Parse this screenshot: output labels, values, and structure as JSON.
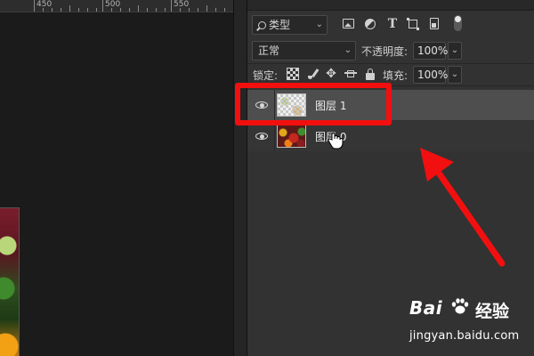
{
  "ruler": {
    "marks": [
      "450",
      "500",
      "550"
    ]
  },
  "filter": {
    "kind_label": "类型",
    "chevron": "⌄"
  },
  "blend": {
    "mode": "正常",
    "opacity_label": "不透明度:",
    "opacity_value": "100%",
    "chevron": "⌄"
  },
  "lock": {
    "label": "锁定:",
    "move_glyph": "✥",
    "fill_label": "填充:",
    "fill_value": "100%",
    "chevron": "⌄"
  },
  "filter_icons": {
    "type_glyph": "T"
  },
  "layers": [
    {
      "name": "图层 1",
      "selected": true,
      "visible": true,
      "thumb": "transparent"
    },
    {
      "name": "图层 0",
      "selected": false,
      "visible": true,
      "thumb": "fruit-image"
    }
  ],
  "annotation": {
    "highlight_color": "#f20f0f",
    "arrow_color": "#f20f0f"
  },
  "watermark": {
    "logo_text": "Bai",
    "brand": "经验",
    "url": "jingyan.baidu.com"
  },
  "colors": {
    "panel_bg": "#323232",
    "selected_row": "#4e4e4e",
    "canvas_bg": "#1b1b1b"
  }
}
